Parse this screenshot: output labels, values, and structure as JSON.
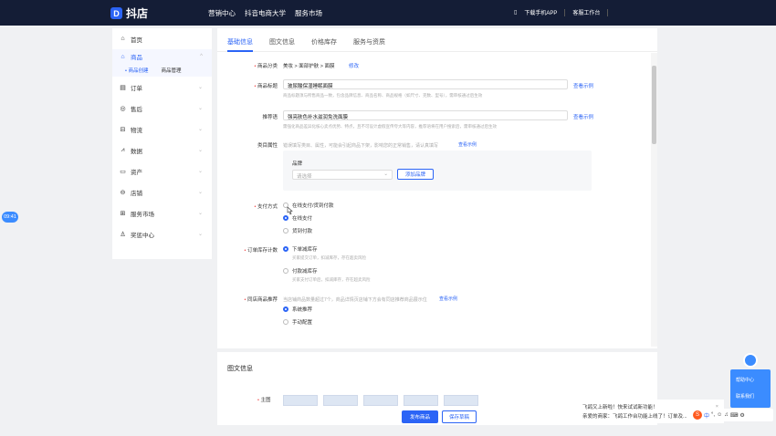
{
  "topbar": {
    "logo_icon": "logo-icon",
    "brand": "抖店",
    "nav": [
      "营销中心",
      "抖音电商大学",
      "服务市场"
    ],
    "download": "下载手机APP",
    "workbench": "客服工作台"
  },
  "sidebar": {
    "items": [
      {
        "label": "首页",
        "icon": "home-icon"
      },
      {
        "label": "商品",
        "icon": "goods-icon"
      },
      {
        "label": "订单",
        "icon": "order-icon"
      },
      {
        "label": "售后",
        "icon": "aftersale-icon"
      },
      {
        "label": "物流",
        "icon": "truck-icon"
      },
      {
        "label": "数据",
        "icon": "chart-icon"
      },
      {
        "label": "资产",
        "icon": "wallet-icon"
      },
      {
        "label": "店铺",
        "icon": "store-icon"
      },
      {
        "label": "服务市场",
        "icon": "grid-icon"
      },
      {
        "label": "奖惩中心",
        "icon": "award-icon"
      }
    ],
    "sub_create": "• 商品创建",
    "sub_manage": "商品管理"
  },
  "tabs": [
    "基础信息",
    "图文信息",
    "价格库存",
    "服务与资质"
  ],
  "form": {
    "category_label": "商品分类",
    "category_value": "美妆 > 面部护肤 > 面膜",
    "category_edit": "修改",
    "title_label": "商品标题",
    "title_value": "玻尿酸保湿睡眠面膜",
    "title_example": "查看示例",
    "title_hint": "商品标题须与所售商品一致，包含品牌信息、商品名称、商品规格（如尺寸、克数、型号），需审核通过后生效",
    "rec_label": "推荐语",
    "rec_value": "强亮肤色补水滋润免洗面膜",
    "rec_example": "查看示例",
    "rec_hint": "需强化商品差异化核心卖点优势、特点，且不可设计虚假宣传夸大等内容，推荐语将在用户搜索后，需审核通过后生效",
    "attr_label": "类目属性",
    "attr_hint": "错误填写类目、属性，可能会引起商品下架，影响您的正常销售，请认真填写",
    "attr_example": "查看示例",
    "brand_label": "品牌",
    "brand_placeholder": "请选择",
    "brand_add": "添加品牌",
    "pay_label": "支付方式",
    "pay_options": [
      "在线支付/货到付款",
      "在线支付",
      "货到付款"
    ],
    "stock_label": "订单库存计数",
    "stock_options": [
      "下单减库存",
      "付款减库存"
    ],
    "stock_hints": [
      "买家提交订单，扣减库存，存在超卖风险",
      "买家支付订单后，扣减库存，存在超卖风险"
    ],
    "same_label": "同店商品推荐",
    "same_hint": "当店铺商品数量超过7个，商品详情页店铺下方会有同店推荐商品展示位",
    "same_example": "查看示例",
    "same_options": [
      "系统推荐",
      "手动配置"
    ]
  },
  "section2": {
    "title": "图文信息",
    "main_image_label": "主图"
  },
  "buttons": {
    "publish": "发布商品",
    "save_draft": "保存草稿"
  },
  "time_badge": "09:41",
  "float_panel": {
    "help": "帮助中心",
    "contact": "联系我们"
  },
  "notification": {
    "line1": "飞鸽又上新啦！快来试试新功能！",
    "line2": "亲爱的商家：飞鸽工作台功能上线了！订单及..."
  },
  "ime": "中"
}
